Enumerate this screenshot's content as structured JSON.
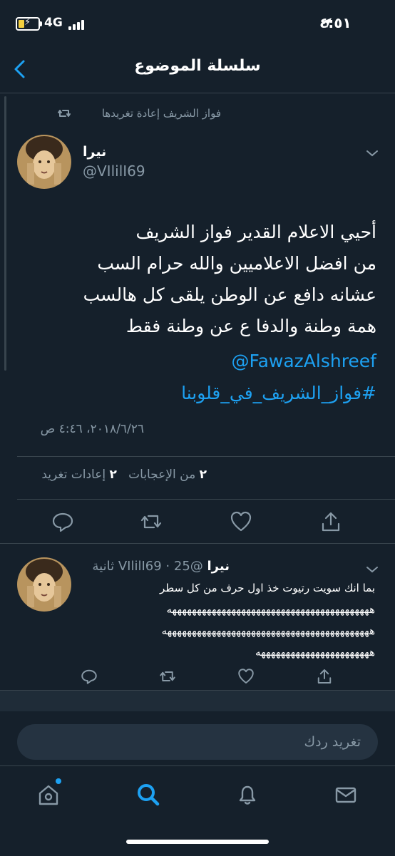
{
  "status_bar": {
    "time": "٤:٥١",
    "network": "4G"
  },
  "header": {
    "title": "سلسلة الموضوع"
  },
  "main_tweet": {
    "retweeted_by": "فواز الشريف إعادة تغريدها",
    "author_name": "نيرا",
    "author_handle": "@VIlilI69",
    "text_lines": [
      "أحيي الاعلام القدير فواز الشريف",
      "من افضل الاعلاميين والله حرام السب",
      "عشانه دافع عن الوطن يلقى كل هالسب",
      "همة وطنة والدفا ع عن وطنة فقط"
    ],
    "mention": "@FawazAlshreef",
    "hashtag": "#فواز_الشريف_في_قلوبنا",
    "timestamp": "٢٠١٨/٦/٢٦، ٤:٤٦ ص",
    "stats": {
      "likes_count": "٢",
      "likes_label": "من الإعجابات",
      "retweets_count": "٢",
      "retweets_label": "إعادات تغريد"
    }
  },
  "reply": {
    "author_name": "نيرا",
    "author_handle": "@VIlilI69",
    "time_ago": "25 ثانية",
    "text": "بما انك سويت رتيوت خذ اول حرف من كل سطر",
    "laugh_line_1": "هههههههههههههههههههههههههههههههههههههههههه",
    "laugh_line_2": "ههههههههههههههههههههههههههههههههههههههههههه",
    "laugh_line_3": "هههههههههههههههههههههههه"
  },
  "composer": {
    "placeholder": "تغريد ردك"
  },
  "colors": {
    "background": "#15202b",
    "accent": "#1da1f2",
    "muted": "#8899a6",
    "border": "#38444d"
  },
  "icons": {
    "back": "chevron-left-icon",
    "retweet": "retweet-icon",
    "more": "chevron-down-icon",
    "reply": "reply-icon",
    "like": "heart-icon",
    "share": "share-icon",
    "home": "home-icon",
    "search": "search-icon",
    "notifications": "bell-icon",
    "messages": "mail-icon"
  }
}
